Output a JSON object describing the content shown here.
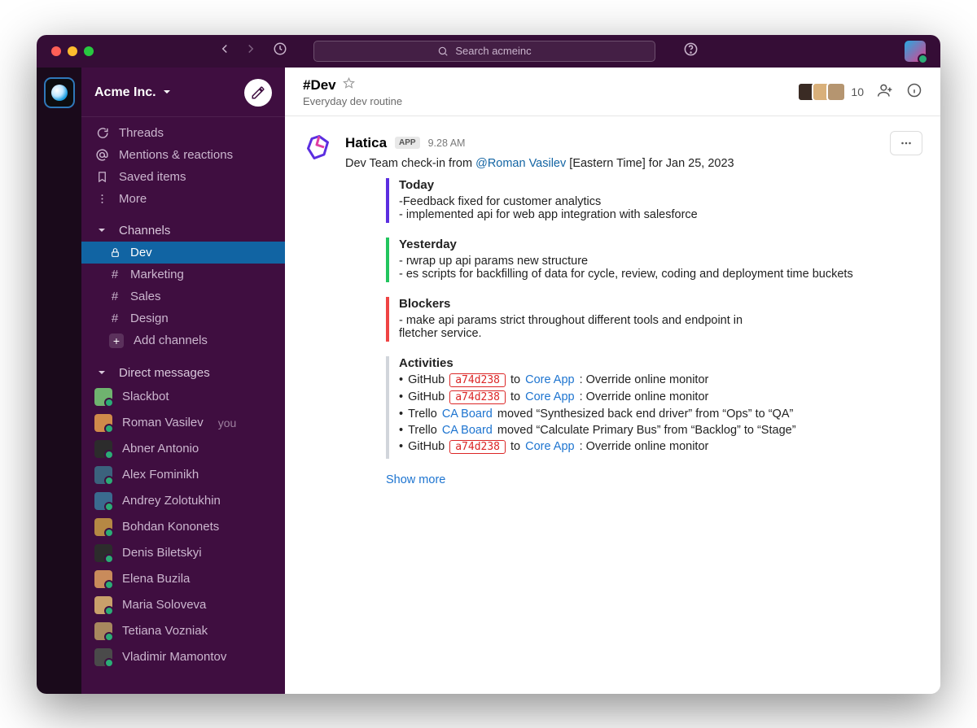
{
  "search": {
    "placeholder": "Search acmeinc"
  },
  "workspace": {
    "name": "Acme Inc."
  },
  "sidebar": {
    "top": [
      {
        "label": "Threads"
      },
      {
        "label": "Mentions & reactions"
      },
      {
        "label": "Saved items"
      },
      {
        "label": "More"
      }
    ],
    "channels_header": "Channels",
    "channels": [
      {
        "label": "Dev",
        "active": true,
        "locked": true
      },
      {
        "label": "Marketing"
      },
      {
        "label": "Sales"
      },
      {
        "label": "Design"
      }
    ],
    "add_channels_label": "Add channels",
    "dms_header": "Direct messages",
    "dms": [
      {
        "name": "Slackbot"
      },
      {
        "name": "Roman Vasilev",
        "you": true
      },
      {
        "name": "Abner Antonio"
      },
      {
        "name": "Alex Fominikh"
      },
      {
        "name": "Andrey Zolotukhin"
      },
      {
        "name": "Bohdan Kononets"
      },
      {
        "name": "Denis Biletskyi"
      },
      {
        "name": "Elena Buzila"
      },
      {
        "name": "Maria Soloveva"
      },
      {
        "name": "Tetiana Vozniak"
      },
      {
        "name": "Vladimir Mamontov"
      }
    ],
    "you_label": "you"
  },
  "channel_header": {
    "name": "#Dev",
    "description": "Everyday dev routine",
    "member_count": "10"
  },
  "message": {
    "app_name": "Hatica",
    "app_badge": "APP",
    "time": "9.28 AM",
    "prefix": "Dev Team check-in  from",
    "mention": "@Roman Vasilev",
    "suffix": "[Eastern Time] for  Jan 25, 2023",
    "today": {
      "title": "Today",
      "lines": [
        "-Feedback fixed for customer analytics",
        "- implemented api for web app integration with salesforce"
      ]
    },
    "yesterday": {
      "title": "Yesterday",
      "lines": [
        "- rwrap up api params new structure",
        "- es scripts for backfilling of data for cycle, review, coding and  deployment time buckets"
      ]
    },
    "blockers": {
      "title": "Blockers",
      "lines": [
        "- make api params strict throughout different tools and endpoint in",
        "fletcher service."
      ]
    },
    "activities": {
      "title": "Activities",
      "rows": [
        {
          "svc": "GitHub",
          "commit": "a74d238",
          "mid": "to",
          "target": "Core App",
          "rest": ": Override online monitor"
        },
        {
          "svc": "GitHub",
          "commit": "a74d238",
          "mid": "to",
          "target": "Core App",
          "rest": ": Override online monitor"
        },
        {
          "svc": "Trello",
          "board": "CA Board",
          "rest": "moved “Synthesized back end driver” from “Ops” to “QA”"
        },
        {
          "svc": "Trello",
          "board": "CA Board",
          "rest": "moved “Calculate Primary Bus” from “Backlog” to “Stage”"
        },
        {
          "svc": "GitHub",
          "commit": "a74d238",
          "mid": "to",
          "target": "Core App",
          "rest": ": Override online monitor"
        }
      ]
    },
    "show_more": "Show more"
  }
}
